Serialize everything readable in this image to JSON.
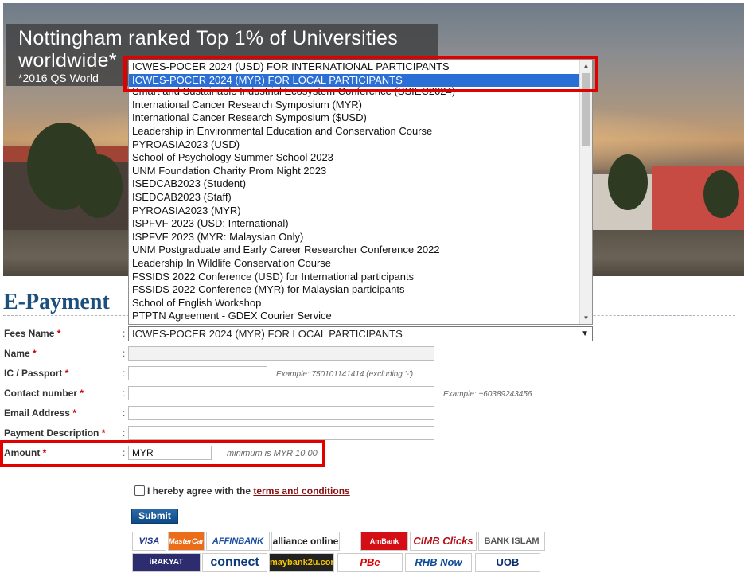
{
  "hero": {
    "title": "Nottingham ranked Top 1% of Universities worldwide*",
    "subtitle": "*2016 QS World"
  },
  "page_title": "E-Payment",
  "form": {
    "fees_name": {
      "label": "Fees Name",
      "req": "*",
      "value": "ICWES-POCER 2024 (MYR) FOR LOCAL PARTICIPANTS"
    },
    "name": {
      "label": "Name",
      "req": "*",
      "value": ""
    },
    "ic": {
      "label": "IC / Passport",
      "req": "*",
      "value": "",
      "hint": "Example: 750101141414 (excluding '-')"
    },
    "contact": {
      "label": "Contact number",
      "req": "*",
      "value": "",
      "hint": "Example: +60389243456"
    },
    "email": {
      "label": "Email Address",
      "req": "*",
      "value": ""
    },
    "description": {
      "label": "Payment Description",
      "req": "*",
      "value": ""
    },
    "amount": {
      "label": "Amount",
      "req": "*",
      "value": "MYR",
      "hint": "minimum is MYR 10.00"
    }
  },
  "colon": ":",
  "dropdown": {
    "options": [
      "ICWES-POCER 2024 (USD) FOR INTERNATIONAL PARTICIPANTS",
      "ICWES-POCER 2024 (MYR) FOR LOCAL PARTICIPANTS",
      "Smart and Sustainable Industrial Ecosystem Conference (SSIEC2024)",
      "International Cancer Research Symposium (MYR)",
      "International Cancer Research Symposium ($USD)",
      "Leadership in Environmental Education and Conservation Course",
      "PYROASIA2023 (USD)",
      "School of Psychology Summer School 2023",
      "UNM Foundation Charity Prom Night 2023",
      "ISEDCAB2023 (Student)",
      "ISEDCAB2023 (Staff)",
      "PYROASIA2023 (MYR)",
      "ISPFVF 2023 (USD: International)",
      "ISPFVF 2023 (MYR: Malaysian Only)",
      "UNM Postgraduate and Early Career Researcher Conference 2022",
      "Leadership In Wildlife Conservation Course",
      "FSSIDS 2022 Conference (USD) for International participants",
      "FSSIDS 2022 Conference (MYR) for Malaysian participants",
      "School of English Workshop",
      "PTPTN Agreement - GDEX Courier Service"
    ],
    "selected_index": 1
  },
  "agree": {
    "text": "I hereby agree with the ",
    "link": "terms and conditions"
  },
  "submit_label": "Submit",
  "banks": {
    "visa": "VISA",
    "mastercard": "MasterCard",
    "affin": "AFFINBANK",
    "alliance": "alliance online",
    "ambank": "AmBank",
    "cimb": "CIMB Clicks",
    "bankislam": "BANK ISLAM",
    "rakyat": "iRAKYAT",
    "hongleong": "connect",
    "maybank": "maybank2u.com",
    "pbe": "PBe",
    "rhb": "RHB Now",
    "uob": "UOB"
  },
  "colors": {
    "title_blue": "#1c4f7b",
    "required_red": "#cc0000",
    "highlight_red": "#e00000",
    "selected_option": "#2a6fd6",
    "submit_blue": "#0d4a86"
  }
}
